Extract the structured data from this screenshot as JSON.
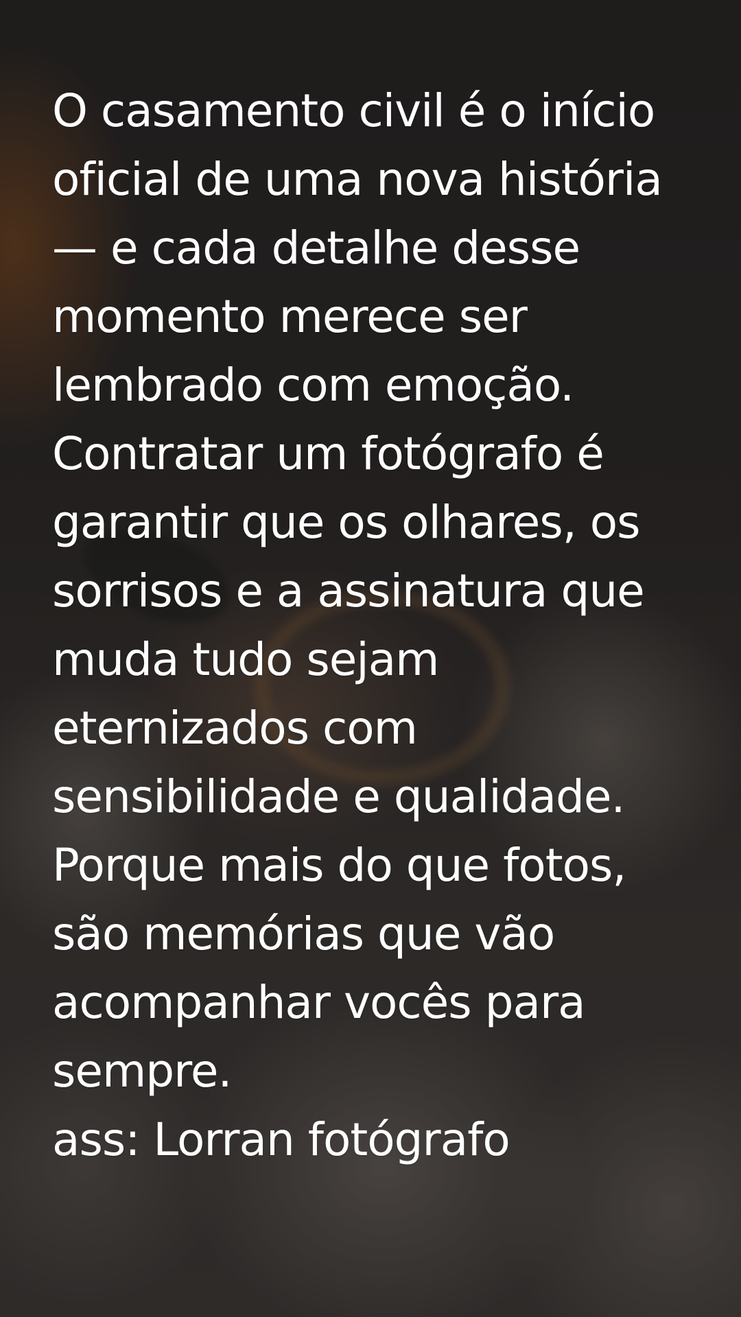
{
  "text": {
    "body": "O casamento civil é o início\noficial de uma nova história\n— e cada detalhe desse\nmomento merece ser\nlembrado com emoção.\nContratar um fotógrafo é\ngarantir que os olhares, os\nsorrisos e a assinatura que\nmuda tudo sejam\neternizados com\nsensibilidade e qualidade.\nPorque mais do que fotos,\nsão memórias que vão\nacompanhar vocês para\nsempre.\nass: Lorran fotógrafo"
  },
  "colors": {
    "text": "#ffffff",
    "background": "#232121"
  }
}
